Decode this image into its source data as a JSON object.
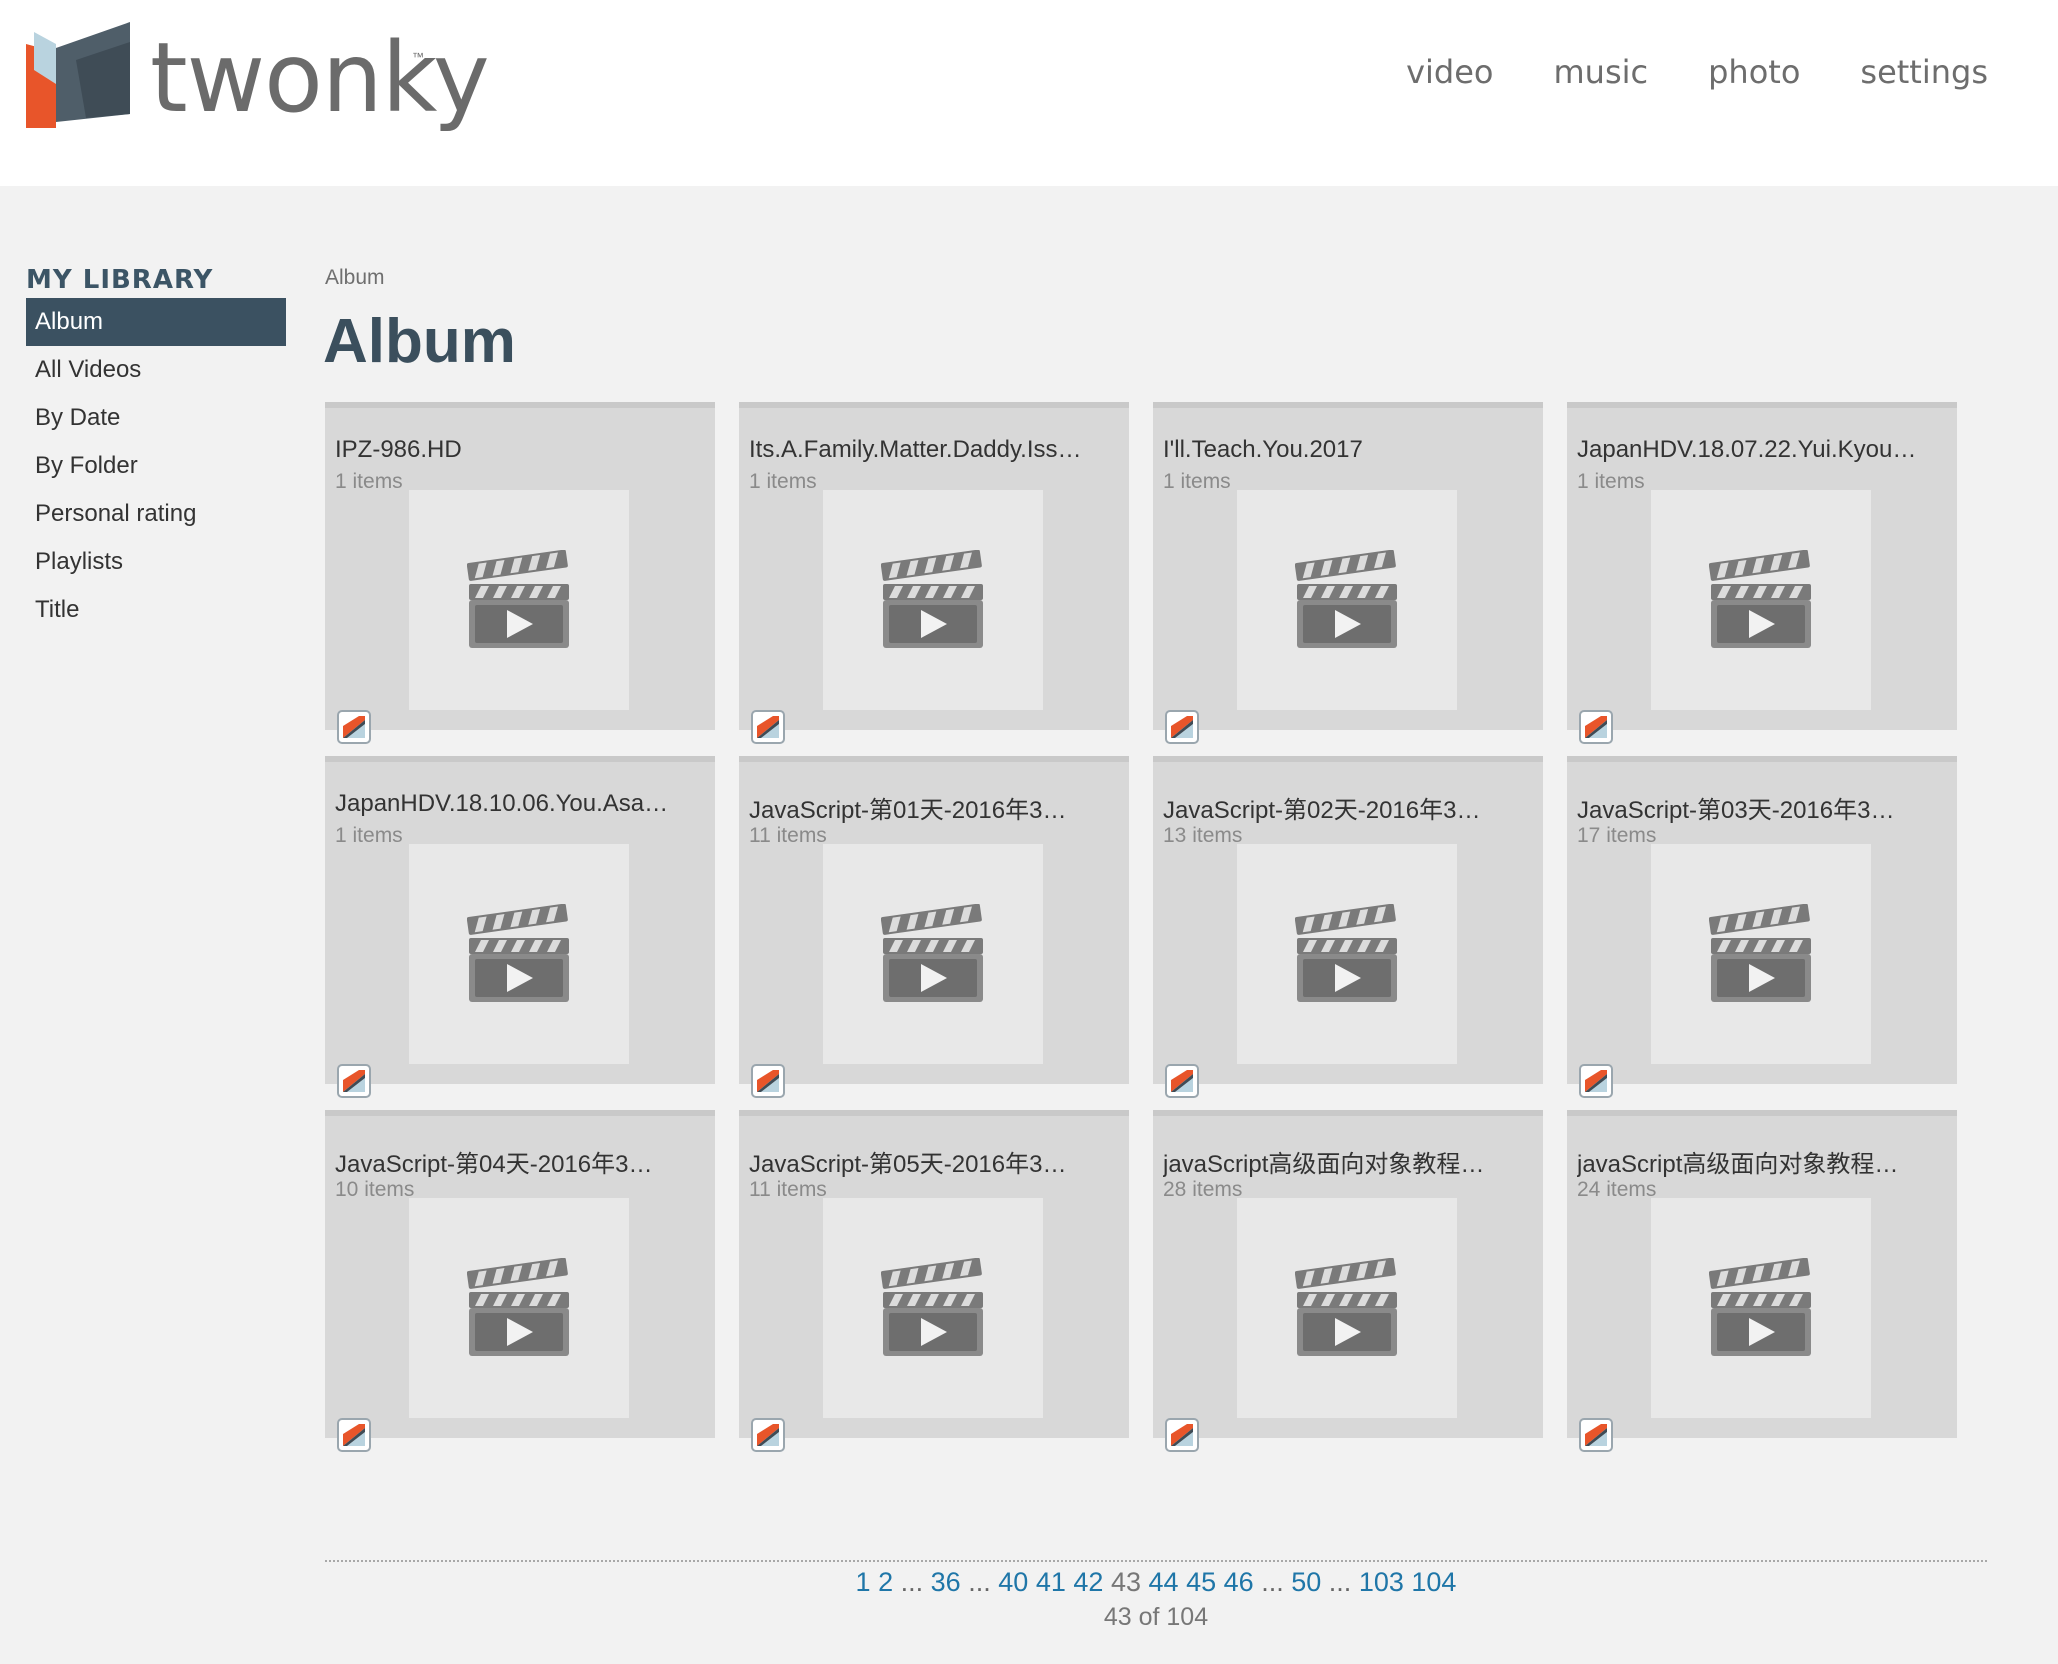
{
  "app": {
    "logo_text": "twonky",
    "logo_icon": "twonky-logo-icon"
  },
  "topnav": [
    "video",
    "music",
    "photo",
    "settings"
  ],
  "sidebar": {
    "title": "MY LIBRARY",
    "items": [
      {
        "label": "Album",
        "active": true
      },
      {
        "label": "All Videos",
        "active": false
      },
      {
        "label": "By Date",
        "active": false
      },
      {
        "label": "By Folder",
        "active": false
      },
      {
        "label": "Personal rating",
        "active": false
      },
      {
        "label": "Playlists",
        "active": false
      },
      {
        "label": "Title",
        "active": false
      }
    ]
  },
  "breadcrumb": "Album",
  "page_title": "Album",
  "albums": [
    {
      "title": "IPZ-986.HD",
      "count": "1 items"
    },
    {
      "title": "Its.A.Family.Matter.Daddy.Iss…",
      "count": "1 items"
    },
    {
      "title": "I'll.Teach.You.2017",
      "count": "1 items"
    },
    {
      "title": "JapanHDV.18.07.22.Yui.Kyou…",
      "count": "1 items"
    },
    {
      "title": "JapanHDV.18.10.06.You.Asa…",
      "count": "1 items"
    },
    {
      "title": "JavaScript-第01天-2016年3…",
      "count": "11 items"
    },
    {
      "title": "JavaScript-第02天-2016年3…",
      "count": "13 items"
    },
    {
      "title": "JavaScript-第03天-2016年3…",
      "count": "17 items"
    },
    {
      "title": "JavaScript-第04天-2016年3…",
      "count": "10 items"
    },
    {
      "title": "JavaScript-第05天-2016年3…",
      "count": "11 items"
    },
    {
      "title": "javaScript高级面向对象教程…",
      "count": "28 items"
    },
    {
      "title": "javaScript高级面向对象教程…",
      "count": "24 items"
    }
  ],
  "album_icon": "video-clapperboard-icon",
  "badge_icon": "twonky-source-badge-icon",
  "pagination": {
    "items": [
      "1",
      "2",
      "...",
      "36",
      "...",
      "40",
      "41",
      "42",
      "43",
      "44",
      "45",
      "46",
      "...",
      "50",
      "...",
      "103",
      "104"
    ],
    "current": "43",
    "status": "43 of 104"
  },
  "colors": {
    "accent": "#3b5161",
    "link": "#1f76a8",
    "logo_orange": "#e8552a",
    "logo_slate": "#4a5a66"
  }
}
